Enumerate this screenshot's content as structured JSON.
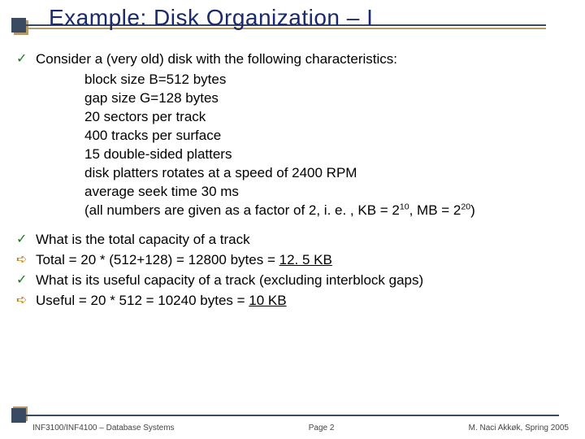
{
  "title": "Example: Disk Organization – I",
  "bullets": {
    "b1_lead": "Consider a (very old) disk with the following characteristics:",
    "b1_sub": [
      "block size B=512 bytes",
      "gap size G=128 bytes",
      "20 sectors per track",
      "400 tracks per surface",
      "15 double-sided platters",
      "disk platters rotates at a speed of 2400 RPM",
      "average seek time 30 ms"
    ],
    "b1_note_pre": "(all numbers are given as a factor of 2, i. e. , KB = 2",
    "b1_note_exp1": "10",
    "b1_note_mid": ", MB = 2",
    "b1_note_exp2": "20",
    "b1_note_post": ")",
    "b2": "What is the total capacity of a track",
    "b3_pre": "Total = 20 * (512+128) = 12800 bytes = ",
    "b3_u": "12. 5 KB",
    "b4": "What is its useful capacity of a track (excluding interblock gaps)",
    "b5_pre": "Useful = 20 * 512 = 10240 bytes = ",
    "b5_u": "10 KB"
  },
  "footer": {
    "left": "INF3100/INF4100 – Database Systems",
    "center": "Page 2",
    "right": "M. Naci Akkøk, Spring 2005"
  }
}
